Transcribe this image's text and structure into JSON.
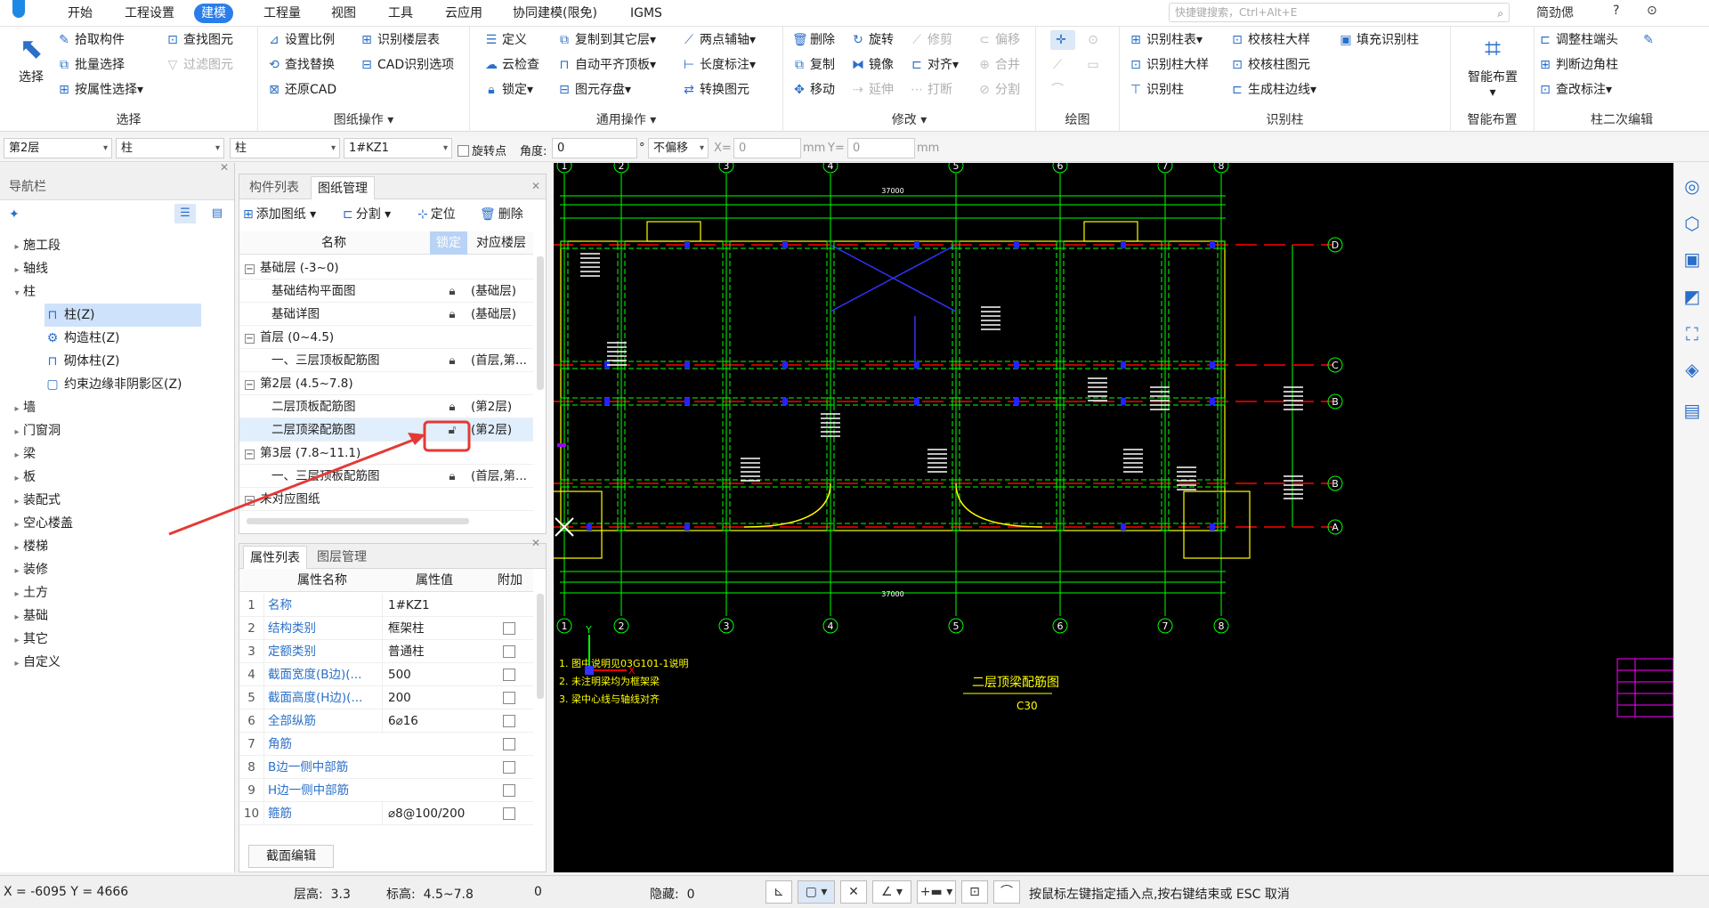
{
  "menu": {
    "tabs": [
      "开始",
      "工程设置",
      "建模",
      "工程量",
      "视图",
      "工具",
      "云应用",
      "协同建模(限免)",
      "IGMS"
    ],
    "active_tab": "建模",
    "search_placeholder": "快捷键搜索，Ctrl+Alt+E",
    "right_tools": [
      "简劲偲",
      "?",
      "⊙"
    ]
  },
  "ribbon": {
    "select": {
      "title": "选择",
      "big": "选择",
      "b1": "拾取构件",
      "b2": "批量选择",
      "b3": "按属性选择",
      "b4": "查找图元",
      "b5": "过滤图元"
    },
    "drawing_ops": {
      "title": "图纸操作",
      "b1": "设置比例",
      "b2": "查找替换",
      "b3": "还原CAD",
      "b4": "识别楼层表",
      "b5": "CAD识别选项"
    },
    "common_ops": {
      "title": "通用操作",
      "b1": "定义",
      "b2": "云检查",
      "b3": "锁定",
      "b4": "复制到其它层",
      "b5": "自动平齐顶板",
      "b6": "图元存盘",
      "b7": "两点辅轴",
      "b8": "长度标注",
      "b9": "转换图元"
    },
    "modify": {
      "title": "修改",
      "b1": "删除",
      "b2": "复制",
      "b3": "移动",
      "b4": "旋转",
      "b5": "镜像",
      "b6": "延伸",
      "b7": "修剪",
      "b8": "对齐",
      "b9": "打断",
      "b10": "偏移",
      "b11": "合并",
      "b12": "分割"
    },
    "draw": {
      "title": "绘图"
    },
    "recog": {
      "title": "识别柱",
      "b1": "识别柱表",
      "b2": "识别柱大样",
      "b3": "识别柱",
      "b4": "校核柱大样",
      "b5": "校核柱图元",
      "b6": "生成柱边线",
      "b7": "填充识别柱"
    },
    "smart": {
      "title": "智能布置",
      "big": "智能布置"
    },
    "edit2": {
      "title": "柱二次编辑",
      "b1": "调整柱端头",
      "b2": "判断边角柱",
      "b3": "查改标注"
    }
  },
  "options": {
    "floor": "第2层",
    "type": "柱",
    "subtype": "柱",
    "component": "1#KZ1",
    "rotate_label": "旋转点",
    "angle_label": "角度:",
    "angle_value": "0",
    "unit_deg": "°",
    "offset": "不偏移",
    "x_label": "X=",
    "x_value": "0",
    "mm1": "mm",
    "y_label": "Y=",
    "y_value": "0",
    "mm2": "mm"
  },
  "nav": {
    "title": "导航栏",
    "items": [
      "施工段",
      "轴线",
      "柱",
      "墙",
      "门窗洞",
      "梁",
      "板",
      "装配式",
      "空心楼盖",
      "楼梯",
      "装修",
      "土方",
      "基础",
      "其它",
      "自定义"
    ],
    "sub": [
      "柱(Z)",
      "构造柱(Z)",
      "砌体柱(Z)",
      "约束边缘非阴影区(Z)"
    ]
  },
  "drawings": {
    "tabs": [
      "构件列表",
      "图纸管理"
    ],
    "tools": [
      "添加图纸",
      "分割",
      "定位",
      "删除"
    ],
    "headers": [
      "名称",
      "锁定",
      "对应楼层"
    ],
    "rows": [
      {
        "name": "基础层 (-3~0)",
        "floor": ""
      },
      {
        "name": "基础结构平面图",
        "floor": "(基础层)"
      },
      {
        "name": "基础详图",
        "floor": "(基础层)"
      },
      {
        "name": "首层 (0~4.5)",
        "floor": ""
      },
      {
        "name": "一、三层顶板配筋图",
        "floor": "(首层,第..."
      },
      {
        "name": "第2层 (4.5~7.8)",
        "floor": ""
      },
      {
        "name": "二层顶板配筋图",
        "floor": "(第2层)"
      },
      {
        "name": "二层顶梁配筋图",
        "floor": "(第2层)"
      },
      {
        "name": "第3层 (7.8~11.1)",
        "floor": ""
      },
      {
        "name": "一、三层顶板配筋图",
        "floor": "(首层,第..."
      },
      {
        "name": "未对应图纸",
        "floor": ""
      }
    ]
  },
  "props": {
    "tabs": [
      "属性列表",
      "图层管理"
    ],
    "headers": [
      "属性名称",
      "属性值",
      "附加"
    ],
    "rows": [
      {
        "n": "1",
        "k": "名称",
        "v": "1#KZ1"
      },
      {
        "n": "2",
        "k": "结构类别",
        "v": "框架柱"
      },
      {
        "n": "3",
        "k": "定额类别",
        "v": "普通柱"
      },
      {
        "n": "4",
        "k": "截面宽度(B边)(...",
        "v": "500"
      },
      {
        "n": "5",
        "k": "截面高度(H边)(...",
        "v": "200"
      },
      {
        "n": "6",
        "k": "全部纵筋",
        "v": "6⌀16"
      },
      {
        "n": "7",
        "k": "角筋",
        "v": ""
      },
      {
        "n": "8",
        "k": "B边一侧中部筋",
        "v": ""
      },
      {
        "n": "9",
        "k": "H边一侧中部筋",
        "v": ""
      },
      {
        "n": "10",
        "k": "箍筋",
        "v": "⌀8@100/200"
      }
    ],
    "section_edit": "截面编辑"
  },
  "cad": {
    "axes_top": [
      "1",
      "2",
      "3",
      "4",
      "5",
      "6",
      "7",
      "8"
    ],
    "axes_side": [
      "D",
      "C",
      "B",
      "B",
      "A"
    ],
    "title": "二层顶梁配筋图",
    "concrete": "C30",
    "notes": [
      "1. 图中说明见03G101-1说明",
      "2. 未注明梁均为框架梁",
      "3. 梁中心线与轴线对齐"
    ],
    "dim_total": "37000"
  },
  "status": {
    "coords": "X = -6095 Y = 4666",
    "floor_h_label": "层高:",
    "floor_h": "3.3",
    "elev_label": "标高:",
    "elev": "4.5~7.8",
    "zero": "0",
    "hidden_label": "隐藏:",
    "hidden": "0",
    "hint": "按鼠标左键指定插入点,按右键结束或 ESC 取消"
  }
}
